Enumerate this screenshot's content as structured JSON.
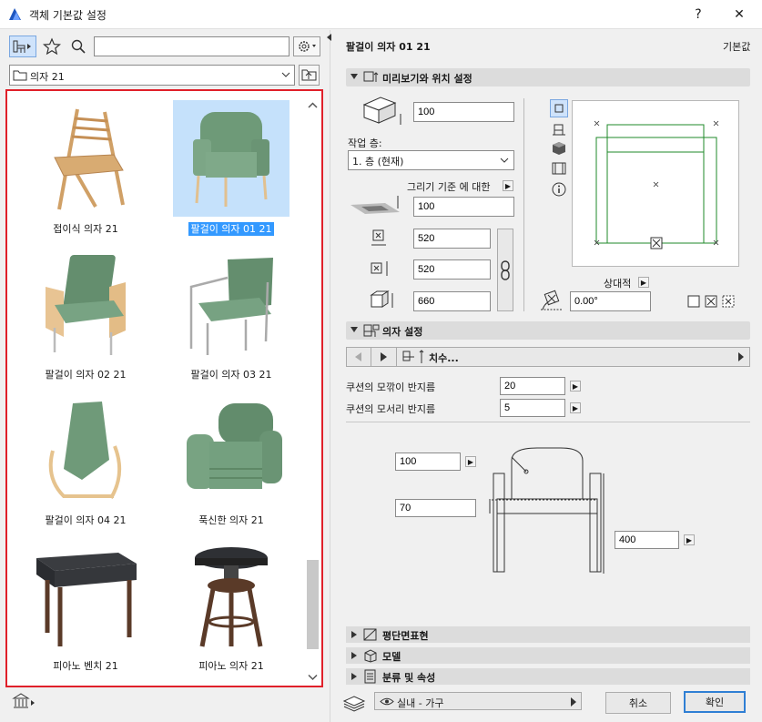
{
  "window": {
    "title": "객체 기본값 설정",
    "help": "?",
    "close": "✕"
  },
  "library": {
    "search_placeholder": "",
    "folder": "의자 21",
    "items": [
      {
        "label": "접이식 의자 21",
        "selected": false
      },
      {
        "label": "팔걸이 의자 01 21",
        "selected": true
      },
      {
        "label": "팔걸이 의자 02 21",
        "selected": false
      },
      {
        "label": "팔걸이 의자 03 21",
        "selected": false
      },
      {
        "label": "팔걸이 의자 04 21",
        "selected": false
      },
      {
        "label": "푹신한 의자 21",
        "selected": false
      },
      {
        "label": "피아노 벤치 21",
        "selected": false
      },
      {
        "label": "피아노 의자 21",
        "selected": false
      }
    ]
  },
  "header": {
    "object_name": "팔걸이 의자 01 21",
    "defaults_label": "기본값"
  },
  "preview_section": {
    "title": "미리보기와 위치 설정",
    "elevation": "100",
    "work_layer_label": "작업 층:",
    "work_layer_value": "1. 층 (현재)",
    "relative_label": "그리기 기준 에 대한",
    "relative_value": "100",
    "width": "520",
    "depth": "520",
    "height": "660",
    "relative_surface_label": "상대적",
    "rotation": "0.00°"
  },
  "chair_section": {
    "title": "의자 설정",
    "page_label": "치수...",
    "cushion_edge_label": "쿠션의 모깎이 반지름",
    "cushion_edge_value": "20",
    "cushion_corner_label": "쿠션의 모서리 반지름",
    "cushion_corner_value": "5",
    "dim_top": "100",
    "dim_seat": "70",
    "dim_height": "400"
  },
  "collapsed_sections": [
    "평단면표현",
    "모델",
    "분류 및 속성"
  ],
  "footer": {
    "layer": "실내 - 가구",
    "cancel": "취소",
    "ok": "확인"
  }
}
